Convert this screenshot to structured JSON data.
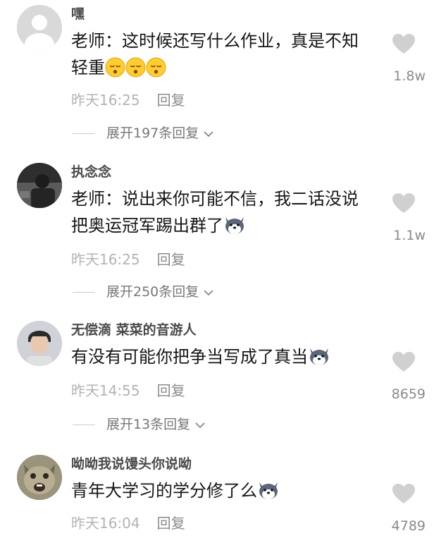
{
  "comments": [
    {
      "username": "嘿",
      "text": "老师：这时候还写什么作业，真是不知轻重",
      "emojis": [
        "sleepy-face-emoji",
        "sleepy-face-emoji",
        "sleepy-face-emoji"
      ],
      "time": "昨天16:25",
      "reply": "回复",
      "likes": "1.8w",
      "expand": "展开197条回复"
    },
    {
      "username": "执念念",
      "text": "老师：说出来你可能不信，我二话没说把奥运冠军踢出群了",
      "emojis": [
        "husky-dog-emoji"
      ],
      "time": "昨天16:25",
      "reply": "回复",
      "likes": "1.1w",
      "expand": "展开250条回复"
    },
    {
      "username": "无偿滴 菜菜的音游人",
      "text": "有没有可能你把争当写成了真当",
      "emojis": [
        "husky-dog-emoji"
      ],
      "time": "昨天14:55",
      "reply": "回复",
      "likes": "8659",
      "expand": "展开13条回复"
    },
    {
      "username": "呦呦我说馒头你说呦",
      "text": "青年大学习的学分修了么",
      "emojis": [
        "husky-dog-emoji"
      ],
      "time": "昨天16:04",
      "reply": "回复",
      "likes": "4789"
    }
  ],
  "colors": {
    "like_icon": "#d0d0d0",
    "meta": "#b3b3b3",
    "username": "#4a4a4a"
  }
}
